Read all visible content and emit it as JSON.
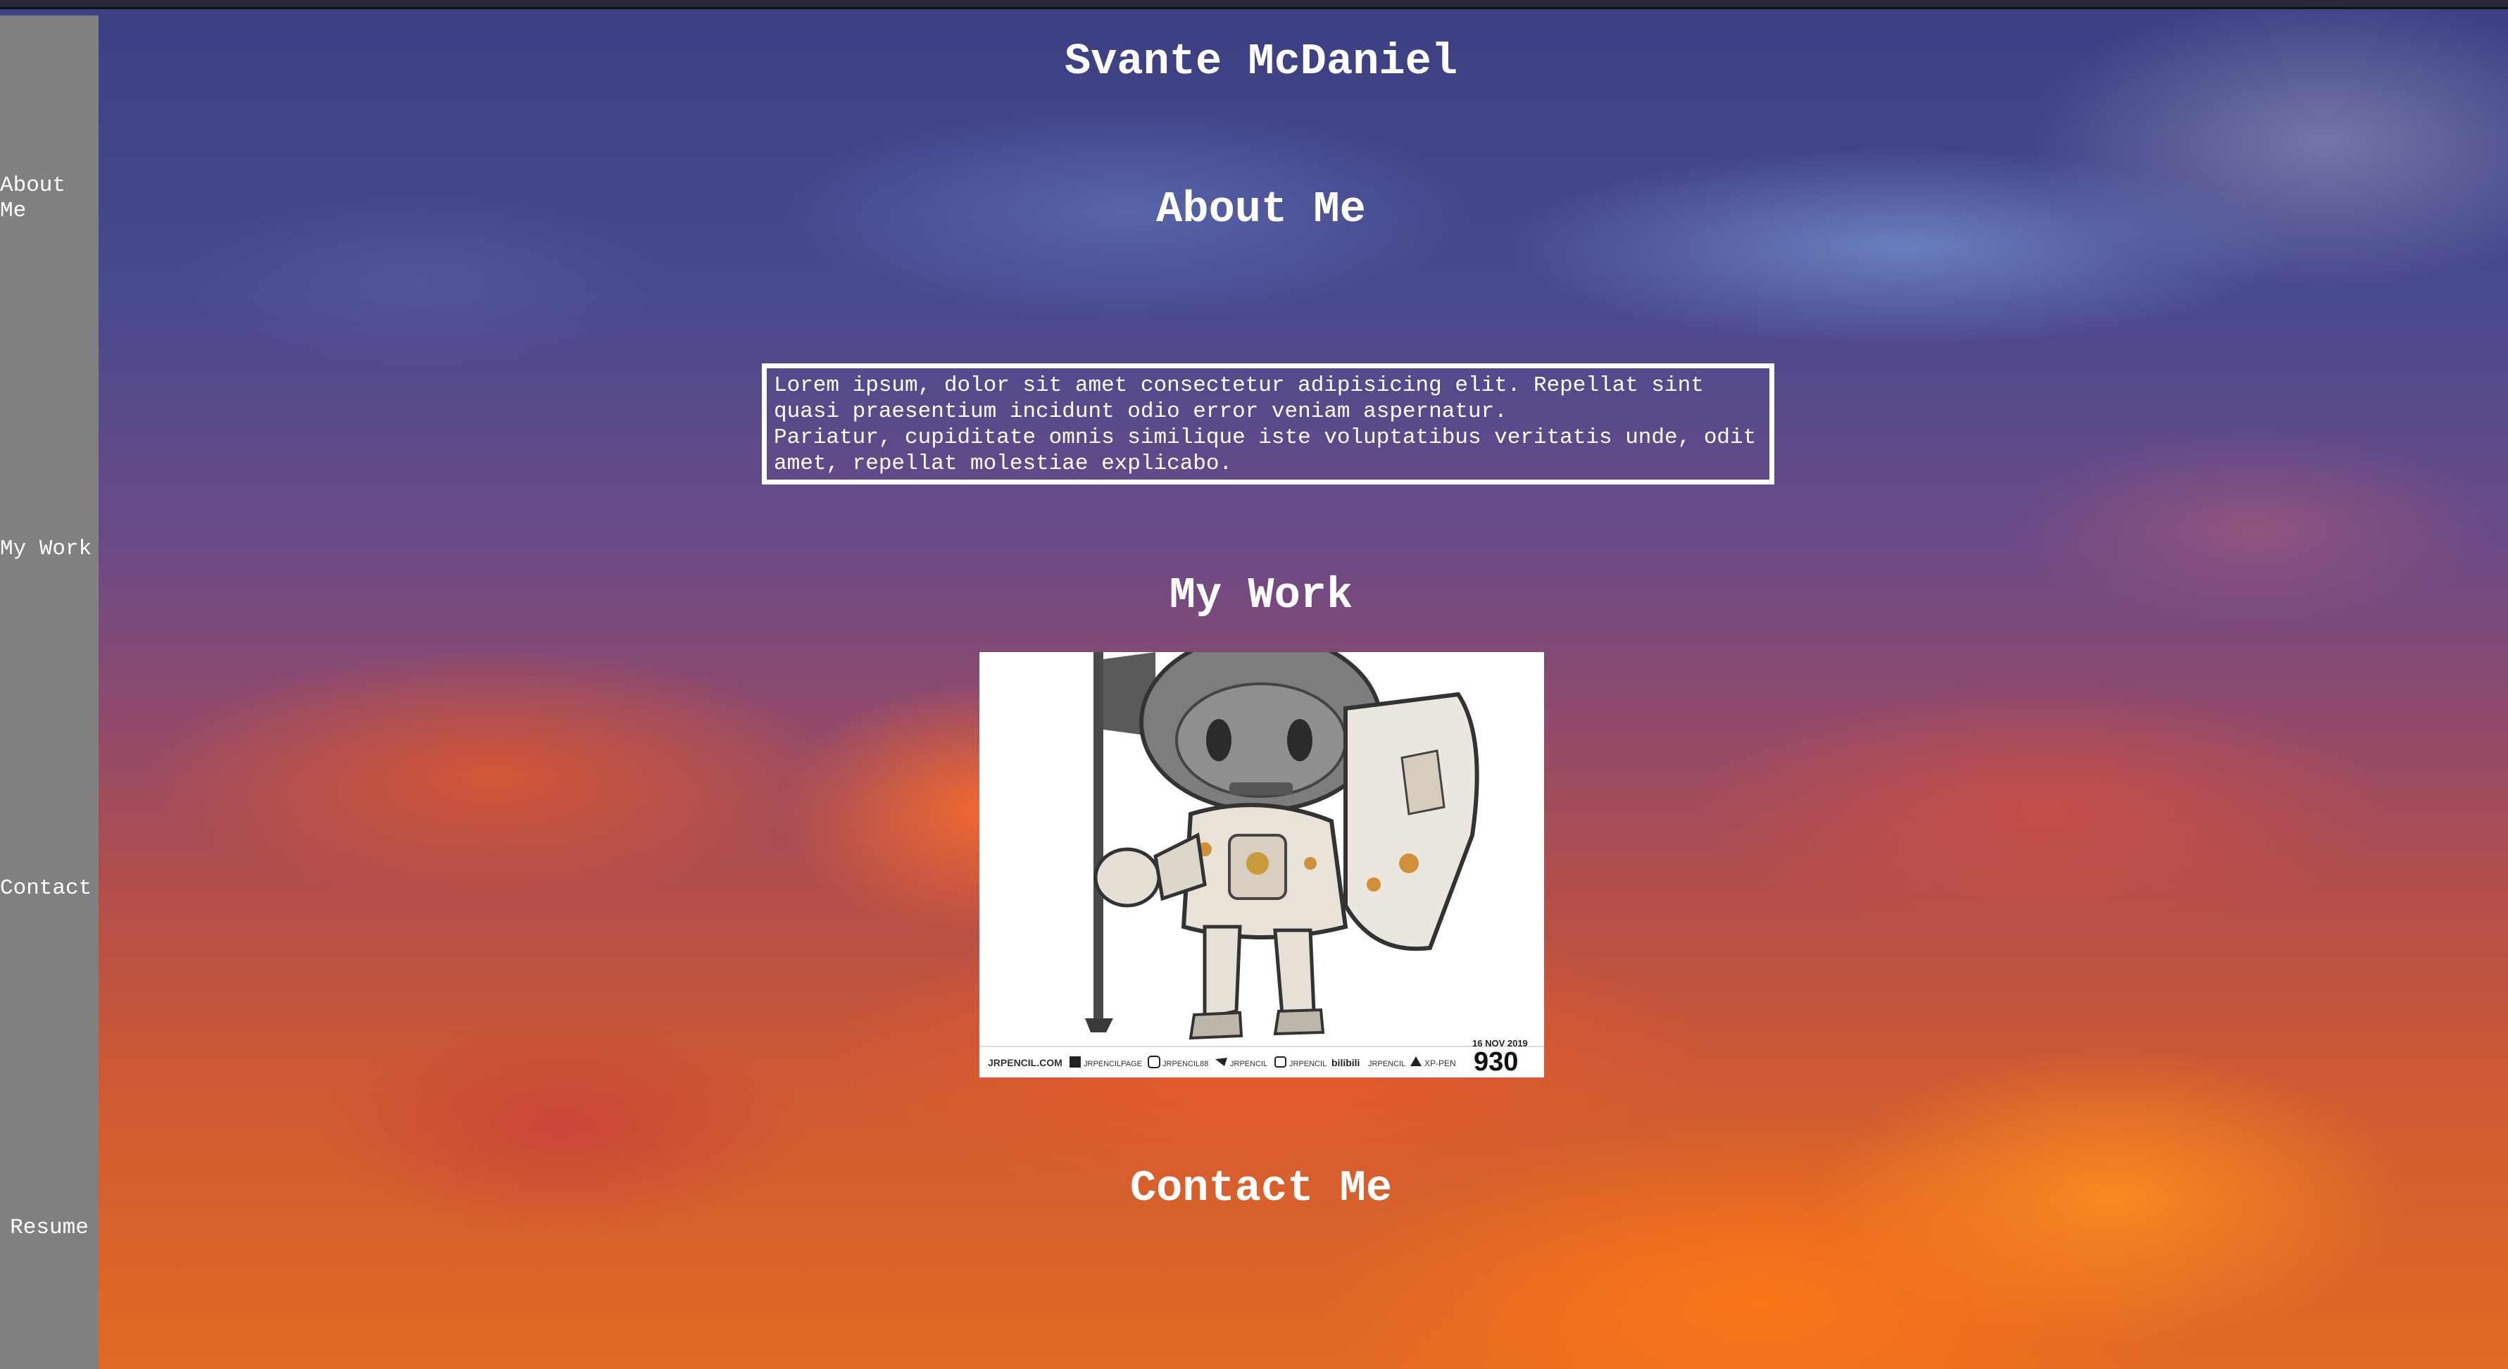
{
  "site": {
    "title": "Svante McDaniel"
  },
  "sidebar": {
    "items": [
      {
        "label": "About Me"
      },
      {
        "label": "My Work"
      },
      {
        "label": "Contact"
      },
      {
        "label": "Resume"
      }
    ]
  },
  "about": {
    "heading": "About Me",
    "paragraph_1": "Lorem ipsum, dolor sit amet consectetur adipisicing elit. Repellat sint quasi praesentium incidunt odio error veniam aspernatur.",
    "paragraph_2": "Pariatur, cupiditate omnis similique iste voluptatibus veritatis unde, odit amet, repellat molestiae explicabo."
  },
  "work": {
    "heading": "My Work",
    "image": {
      "caption_left": "JRPENCIL.COM",
      "social": [
        "JRPENCILPAGE",
        "JRPENCIL88",
        "JRPENCIL",
        "JRPENCIL",
        "JRPENCIL",
        "XP-PEN"
      ],
      "date": "16 NOV 2019",
      "number": "930"
    }
  },
  "contact": {
    "heading": "Contact Me"
  }
}
